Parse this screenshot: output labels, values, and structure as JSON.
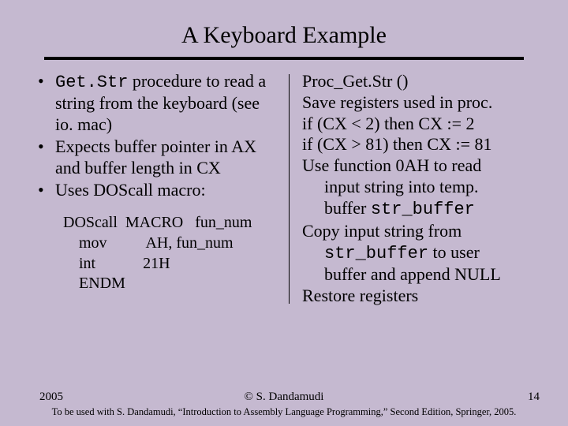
{
  "title": "A Keyboard Example",
  "left": {
    "bullets": [
      {
        "pre_code": "Get.Str",
        "post": " procedure to read a string from the keyboard (see io. mac)"
      },
      {
        "pre_code": "",
        "post": "Expects buffer pointer in AX and buffer length in CX"
      },
      {
        "pre_code": "",
        "post": "Uses DOScall macro:"
      }
    ],
    "macro": {
      "l1a": "DOScall  MACRO   fun_num",
      "l2a": "    mov          AH, fun_num",
      "l3a": "    int            21H",
      "l4a": "    ENDM"
    }
  },
  "right": {
    "l1": "Proc_Get.Str ()",
    "l2": "Save registers used in proc.",
    "l3": "if (CX < 2) then CX := 2",
    "l4": "if (CX > 81) then CX := 81",
    "l5": "Use function 0AH to read",
    "l5b": "input string into temp.",
    "l5c_pre": "buffer ",
    "l5c_code": "str_buffer",
    "l6": "Copy input string from",
    "l6b_code": "str_buffer",
    "l6b_post": " to user",
    "l6c": "buffer and append NULL",
    "l7": "Restore registers"
  },
  "footer": {
    "year": "2005",
    "center": "© S. Dandamudi",
    "page": "14",
    "note": "To be used with S. Dandamudi, “Introduction to Assembly Language Programming,” Second Edition, Springer, 2005."
  }
}
